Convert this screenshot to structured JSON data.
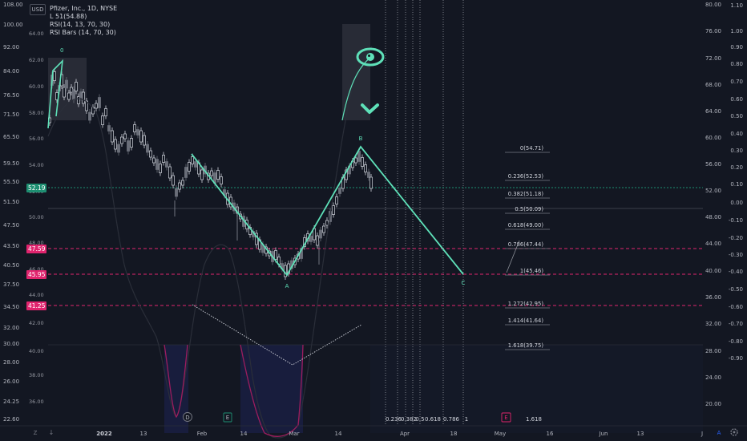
{
  "header": {
    "currency": "USD",
    "title": "Pfizer, Inc., 1D, NYSE",
    "indicator1": "L 51(54.88)",
    "indicator2": "RSI(14, 13, 70, 30)",
    "indicator3": "RSI Bars (14, 70, 30)"
  },
  "axes": {
    "price_left": [
      "108.00",
      "100.00",
      "92.00",
      "84.00",
      "76.50",
      "71.50",
      "65.50",
      "59.50",
      "55.50",
      "51.50",
      "47.50",
      "43.50",
      "40.50",
      "37.50",
      "34.50",
      "32.00",
      "30.00",
      "28.00",
      "26.00",
      "24.25",
      "22.60"
    ],
    "price_inner": [
      "64.00",
      "62.00",
      "60.00",
      "58.00",
      "56.00",
      "54.00",
      "52.00",
      "50.00",
      "48.00",
      "46.00",
      "44.00",
      "42.00",
      "40.00",
      "38.00",
      "36.00"
    ],
    "right_outer": [
      "1.10",
      "1.00",
      "0.90",
      "0.80",
      "0.70",
      "0.60",
      "0.50",
      "0.40",
      "0.30",
      "0.20",
      "0.10",
      "0.00",
      "-0.10",
      "-0.20",
      "-0.30",
      "-0.40",
      "-0.50",
      "-0.60",
      "-0.70",
      "-0.80",
      "-0.90"
    ],
    "right_inner": [
      "80.00",
      "76.00",
      "72.00",
      "68.00",
      "64.00",
      "60.00",
      "56.00",
      "52.00",
      "48.00",
      "44.00",
      "40.00",
      "36.00",
      "32.00",
      "28.00",
      "24.00",
      "20.00"
    ],
    "time": [
      "2022",
      "13",
      "Feb",
      "14",
      "Mar",
      "14",
      "Apr",
      "18",
      "May",
      "16",
      "Jun",
      "13",
      "J"
    ]
  },
  "price_tags": [
    {
      "label": "52.19",
      "color": "#1e8f72"
    },
    {
      "label": "47.59",
      "color": "#e0246e"
    },
    {
      "label": "45.95",
      "color": "#e0246e"
    },
    {
      "label": "41.25",
      "color": "#e0246e"
    }
  ],
  "wave_labels": {
    "start": "0",
    "a": "A",
    "b": "B",
    "c": "C"
  },
  "fib_levels": [
    {
      "label": "0(54.71)"
    },
    {
      "label": "0.236(52.53)"
    },
    {
      "label": "0.382(51.18)"
    },
    {
      "label": "0.5(50.09)"
    },
    {
      "label": "0.618(49.00)"
    },
    {
      "label": "0.786(47.44)"
    },
    {
      "label": "1(45.46)"
    },
    {
      "label": "1.272(42.95)"
    },
    {
      "label": "1.414(41.64)"
    },
    {
      "label": "1.618(39.75)"
    }
  ],
  "time_fib_labels": [
    "0.236",
    "0.382",
    "0.5",
    "0.618",
    "0.786",
    "1",
    "1.618"
  ],
  "event_markers": [
    "D",
    "E",
    "E"
  ],
  "bottom_icons": {
    "left": "Z",
    "mid": "↓",
    "right_toggle": "A",
    "gear": "gear-icon"
  },
  "colors": {
    "bg": "#131722",
    "wave": "#5ee0b8",
    "bull": "#d1d4dc",
    "bear": "#8a8e99",
    "fib_pink": "#e0246e",
    "rsi": "#9c1d5e"
  }
}
